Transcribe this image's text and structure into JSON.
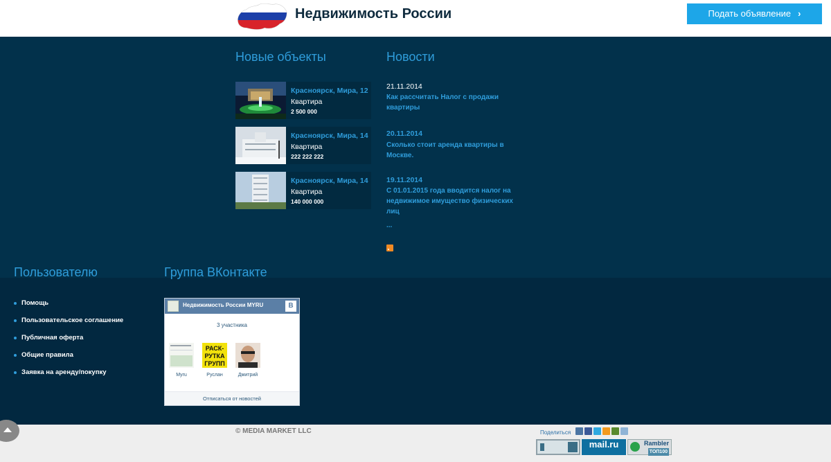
{
  "header": {
    "site_title": "Недвижимость России",
    "post_button_label": "Подать объявление",
    "post_button_chevron": "›"
  },
  "new_objects": {
    "title": "Новые объекты",
    "items": [
      {
        "city": "Красноярск, Мира, 12",
        "type": "Квартира",
        "price": "2 500 000"
      },
      {
        "city": "Красноярск, Мира, 14",
        "type": "Квартира",
        "price": "222 222 222"
      },
      {
        "city": "Красноярск, Мира, 14",
        "type": "Квартира",
        "price": "140 000 000"
      }
    ]
  },
  "news": {
    "title": "Новости",
    "items": [
      {
        "date": "21.11.2014",
        "text": "Как рассчитать Налог с продажи квартиры"
      },
      {
        "date": "20.11.2014",
        "text": "Сколько стоит аренда квартиры в Москве."
      },
      {
        "date": "19.11.2014",
        "text": "С 01.01.2015 года  вводится  налог на недвижимое имущество физических лиц"
      }
    ],
    "more": "..."
  },
  "user_section": {
    "title": "Пользователю",
    "links": [
      "Помощь",
      "Пользовательское соглашение",
      "Публичная оферта",
      "Общие правила",
      "Заявка на аренду/покупку"
    ]
  },
  "vk_group": {
    "title": "Группа ВКонтакте",
    "group_name": "Недвижимость России MYRU",
    "vk_logo": "В",
    "member_count": "3 участника",
    "members": [
      "Myru",
      "Руслан",
      "Дмитрий"
    ],
    "member2_pic_text": "РАСК-\nРУТКА\nГРУПП",
    "unsubscribe": "Отписаться от новостей"
  },
  "footer": {
    "copyright": "© MEDIA MARKET LLC",
    "share_label": "Поделиться",
    "mailru_label": "mail.ru",
    "rambler_label": "Rambler",
    "rambler_sub": "ТОП100"
  },
  "colors": {
    "accent": "#2f9ddb",
    "header_bg": "#ffffff",
    "main_bg": "#02314b",
    "footer_bg": "#022840",
    "button_bg": "#1da6e8"
  }
}
